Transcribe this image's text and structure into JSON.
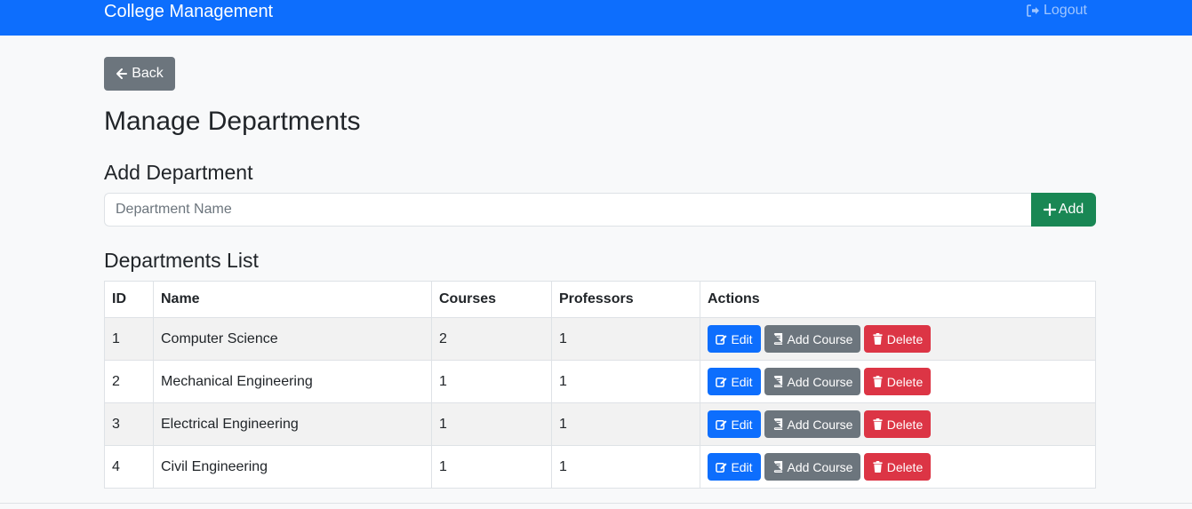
{
  "navbar": {
    "brand": "College Management",
    "logout_label": "Logout"
  },
  "back_label": "Back",
  "page_title": "Manage Departments",
  "add_section": {
    "heading": "Add Department",
    "placeholder": "Department Name",
    "value": "",
    "add_label": "Add"
  },
  "list_section": {
    "heading": "Departments List",
    "columns": [
      "ID",
      "Name",
      "Courses",
      "Professors",
      "Actions"
    ],
    "rows": [
      {
        "id": "1",
        "name": "Computer Science",
        "courses": "2",
        "professors": "1"
      },
      {
        "id": "2",
        "name": "Mechanical Engineering",
        "courses": "1",
        "professors": "1"
      },
      {
        "id": "3",
        "name": "Electrical Engineering",
        "courses": "1",
        "professors": "1"
      },
      {
        "id": "4",
        "name": "Civil Engineering",
        "courses": "1",
        "professors": "1"
      }
    ],
    "actions": {
      "edit_label": "Edit",
      "add_course_label": "Add Course",
      "delete_label": "Delete"
    }
  },
  "colors": {
    "navbar": "#0d6efd",
    "back_button": "#6c757d",
    "add_button": "#198754",
    "edit_button": "#0d6efd",
    "add_course_button": "#6c757d",
    "delete_button": "#dc3545"
  },
  "icons": {
    "logout": "sign-out-icon",
    "back": "arrow-left-icon",
    "add": "plus-icon",
    "edit": "edit-icon",
    "add_course": "book-icon",
    "delete": "trash-icon"
  }
}
